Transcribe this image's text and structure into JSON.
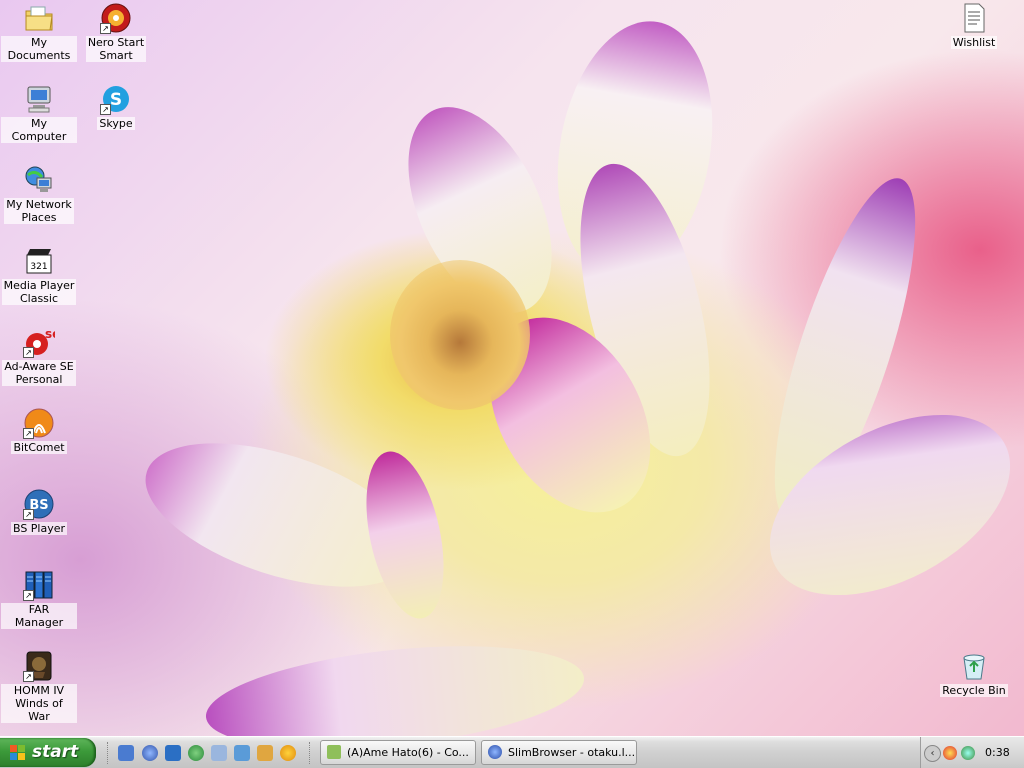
{
  "desktop": {
    "icons_left": [
      {
        "label": "My Documents",
        "icon": "folder-documents-icon"
      },
      {
        "label": "Nero Start\nSmart",
        "icon": "nero-icon"
      },
      {
        "label": "My Computer",
        "icon": "computer-icon"
      },
      {
        "label": "Skype",
        "icon": "skype-icon"
      },
      {
        "label": "My Network\nPlaces",
        "icon": "network-places-icon"
      },
      {
        "label": "Media Player\nClassic",
        "icon": "media-player-classic-icon"
      },
      {
        "label": "Ad-Aware SE\nPersonal",
        "icon": "ad-aware-icon"
      },
      {
        "label": "BitComet",
        "icon": "bitcomet-icon"
      },
      {
        "label": "BS Player",
        "icon": "bs-player-icon"
      },
      {
        "label": "FAR Manager",
        "icon": "far-manager-icon"
      },
      {
        "label": "HOMM IV\nWinds of War",
        "icon": "homm-icon"
      }
    ],
    "icons_right": [
      {
        "label": "Wishlist",
        "icon": "text-document-icon"
      },
      {
        "label": "Recycle Bin",
        "icon": "recycle-bin-icon"
      }
    ]
  },
  "taskbar": {
    "start_label": "start",
    "tasks": [
      {
        "label": "(A)Ame Hato(6) - Co...",
        "icon": "chat-icon"
      },
      {
        "label": "SlimBrowser - otaku.l...",
        "icon": "browser-icon"
      }
    ],
    "clock": "0:38",
    "colors": {
      "start": "#3c9a3a",
      "taskbar": "#d0d0d0"
    }
  }
}
